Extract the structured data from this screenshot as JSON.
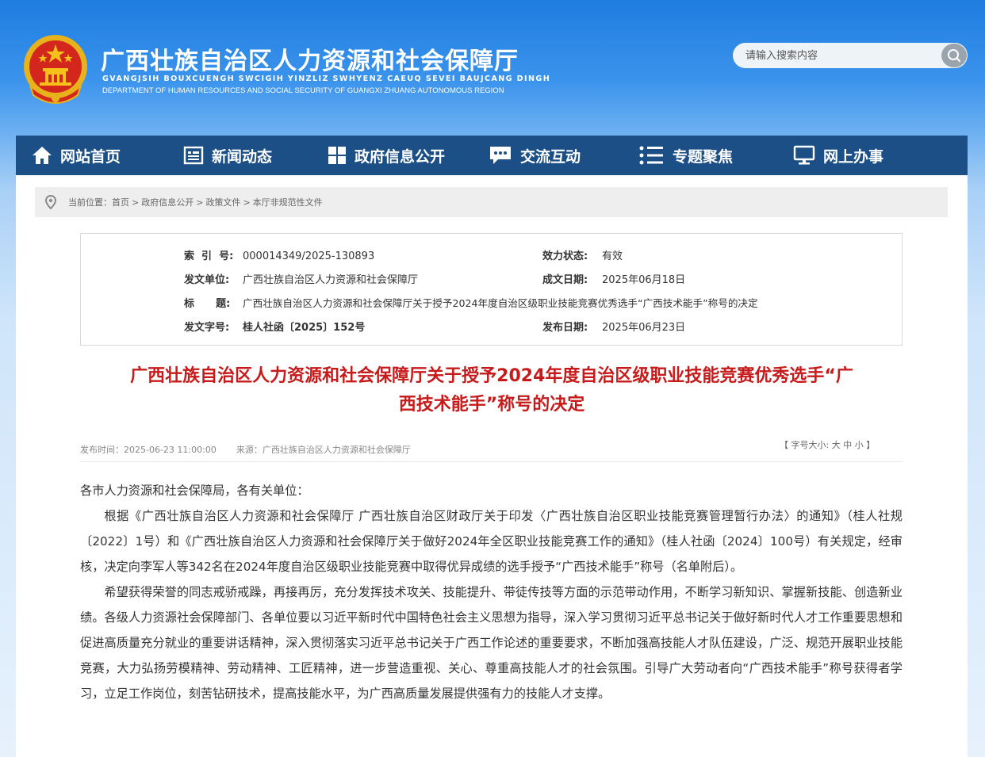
{
  "header": {
    "title": "广西壮族自治区人力资源和社会保障厅",
    "subtitle_zhuang": "GVANGJSIH BOUXCUENGH SWCIGIH YINZLIZ SWHYENZ CAEUQ SEVEI BAUJCANG DINGH",
    "subtitle_en": "DEPARTMENT OF HUMAN RESOURCES AND SOCIAL SECURITY OF GUANGXI ZHUANG AUTONOMOUS REGION",
    "search_placeholder": "请输入搜索内容",
    "emblem_icon": "national-emblem",
    "colors": {
      "brand_blue": "#1f7de0",
      "nav_bg": "#1b4f85",
      "title_red": "#c71a1a"
    }
  },
  "nav": {
    "items": [
      {
        "label": "网站首页",
        "icon": "home-icon"
      },
      {
        "label": "新闻动态",
        "icon": "news-icon"
      },
      {
        "label": "政府信息公开",
        "icon": "grid-icon"
      },
      {
        "label": "交流互动",
        "icon": "chat-icon"
      },
      {
        "label": "专题聚焦",
        "icon": "list-icon"
      },
      {
        "label": "网上办事",
        "icon": "monitor-icon"
      }
    ]
  },
  "breadcrumb": {
    "prefix": "当前位置：",
    "items": [
      "首页",
      "政府信息公开",
      "政策文件",
      "本厅非规范性文件"
    ],
    "separator": ">"
  },
  "meta": {
    "index_label": "索  引  号:",
    "index_value": "000014349/2025-130893",
    "status_label": "效力状态:",
    "status_value": "有效",
    "unit_label": "发文单位:",
    "unit_value": "广西壮族自治区人力资源和社会保障厅",
    "date_label": "成文日期:",
    "date_value": "2025年06月18日",
    "title_label": "标      题:",
    "title_value": "广西壮族自治区人力资源和社会保障厅关于授予2024年度自治区级职业技能竞赛优秀选手“广西技术能手”称号的决定",
    "docno_label": "发文字号:",
    "docno_value": "桂人社函〔2025〕152号",
    "pubdate_label": "发布日期:",
    "pubdate_value": "2025年06月23日"
  },
  "article": {
    "title_line1": "广西壮族自治区人力资源和社会保障厅关于授予2024年度自治区级职业技能竞赛优秀选手“广",
    "title_line2": "西技术能手”称号的决定",
    "publish_time": "发布时间：2025-06-23 11:00:00",
    "source": "来源：广西壮族自治区人力资源和社会保障厅",
    "font_ctl_prefix": "【 字号大小:",
    "font_large": "大",
    "font_medium": "中",
    "font_small": "小",
    "font_ctl_suffix": "】",
    "salutation": "各市人力资源和社会保障局，各有关单位：",
    "para1": "根据《广西壮族自治区人力资源和社会保障厅 广西壮族自治区财政厅关于印发〈广西壮族自治区职业技能竞赛管理暂行办法〉的通知》（桂人社规〔2022〕1号）和《广西壮族自治区人力资源和社会保障厅关于做好2024年全区职业技能竞赛工作的通知》（桂人社函〔2024〕100号）有关规定，经审核，决定向李军人等342名在2024年度自治区级职业技能竞赛中取得优异成绩的选手授予“广西技术能手”称号（名单附后）。",
    "para2": "希望获得荣誉的同志戒骄戒躁，再接再厉，充分发挥技术攻关、技能提升、带徒传技等方面的示范带动作用，不断学习新知识、掌握新技能、创造新业绩。各级人力资源社会保障部门、各单位要以习近平新时代中国特色社会主义思想为指导，深入学习贯彻习近平总书记关于做好新时代人才工作重要思想和促进高质量充分就业的重要讲话精神，深入贯彻落实习近平总书记关于广西工作论述的重要要求，不断加强高技能人才队伍建设，广泛、规范开展职业技能竞赛，大力弘扬劳模精神、劳动精神、工匠精神，进一步营造重视、关心、尊重高技能人才的社会氛围。引导广大劳动者向“广西技术能手”称号获得者学习，立足工作岗位，刻苦钻研技术，提高技能水平，为广西高质量发展提供强有力的技能人才支撑。"
  }
}
